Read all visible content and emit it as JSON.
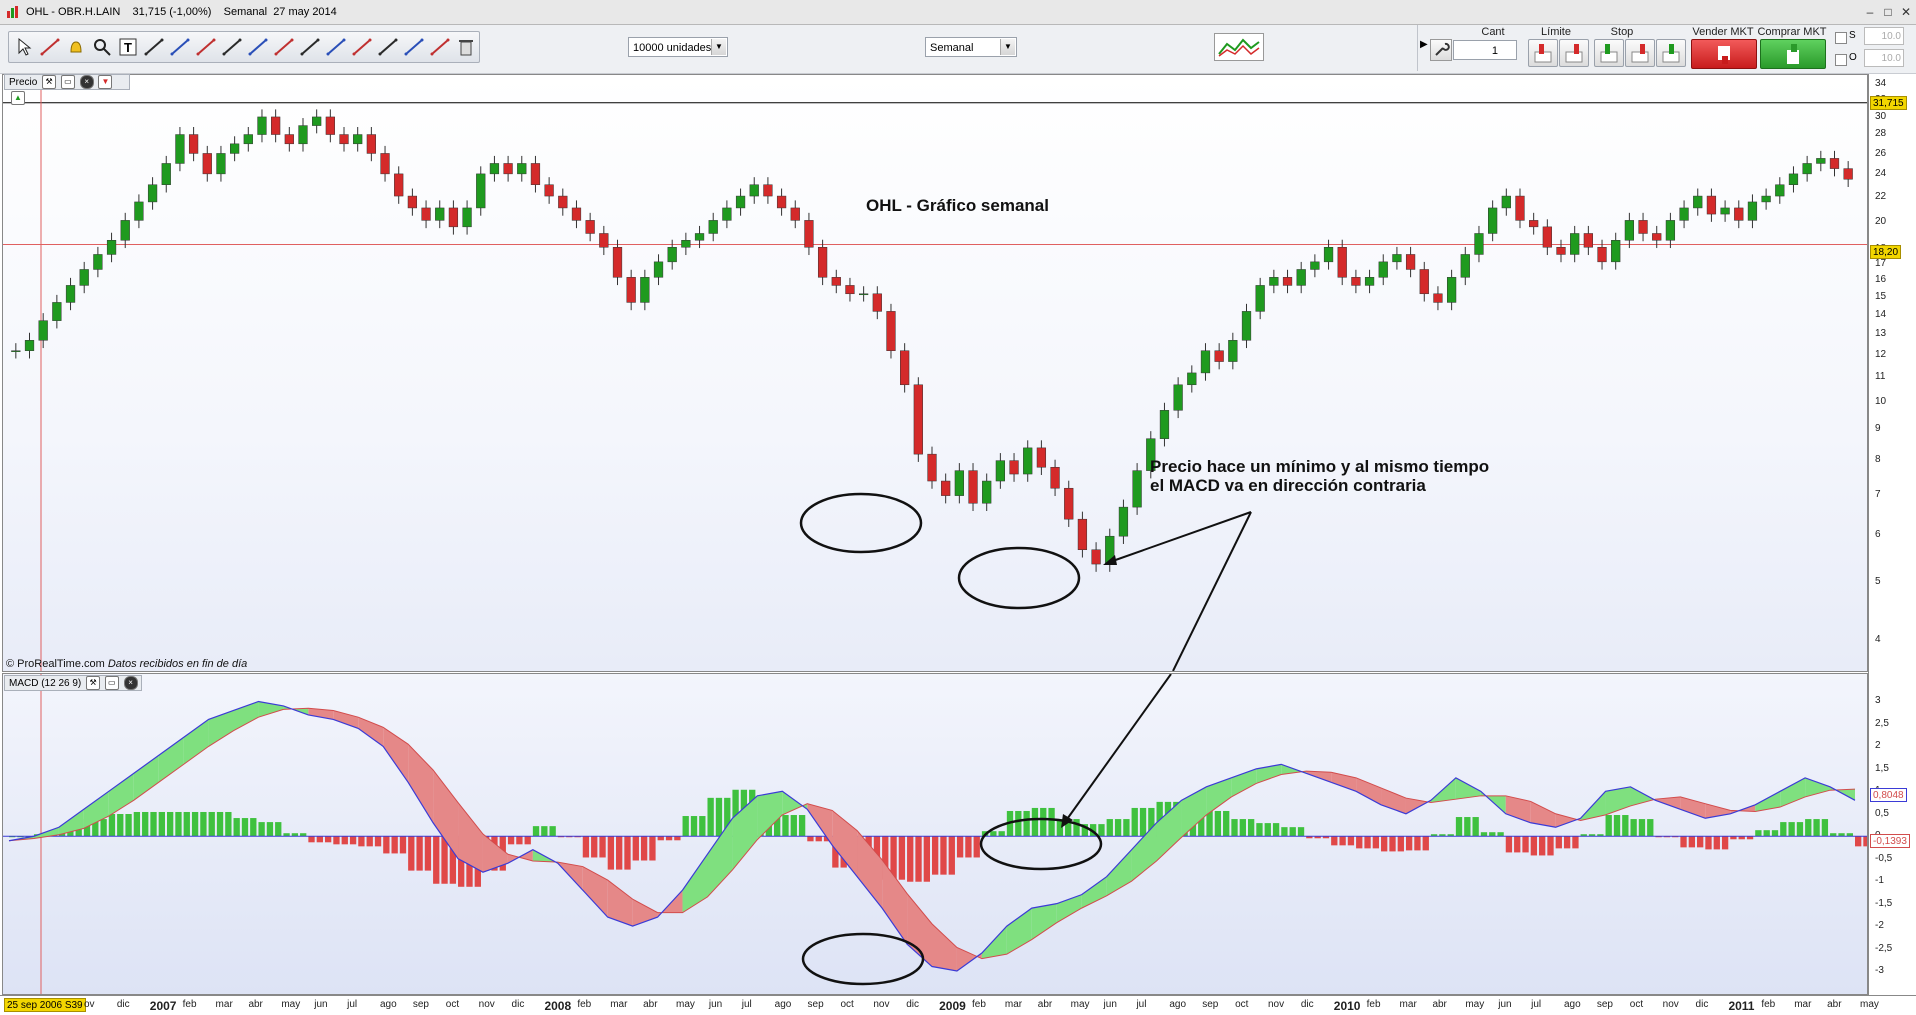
{
  "window": {
    "title": "OHL - OBR.H.LAIN    31,715 (-1,00%)    Semanal  27 may 2014",
    "minimize": "–",
    "maximize": "□",
    "close": "✕"
  },
  "toolbar": {
    "tools": [
      "cursor-icon",
      "ruler-icon",
      "alert-bell-icon",
      "zoom-icon",
      "text-icon",
      "trendline-red-icon",
      "fibonacci-icon",
      "line-icon",
      "ray-icon",
      "horizontal-line-icon",
      "vertical-line-icon",
      "channel-icon",
      "grid-icon",
      "zigzag-icon",
      "hammer-icon",
      "multiline-icon",
      "cross-icon",
      "trash-icon"
    ],
    "units_dropdown": "10000 unidades",
    "period_dropdown": "Semanal",
    "indicator_icon": "chart-thumbnail-icon"
  },
  "order_panel": {
    "cant_label": "Cant",
    "cant_value": "1",
    "limite_label": "Límite",
    "stop_label": "Stop",
    "sell_label": "Vender MKT",
    "buy_label": "Comprar MKT",
    "s_label": "S",
    "o_label": "O",
    "field1": "10.0",
    "field2": "10.0"
  },
  "price_pane": {
    "tab_label": "Precio",
    "chart_title": "OHL - Gráfico semanal",
    "annotation_line1": "Precio hace un mínimo y al mismo tiempo",
    "annotation_line2": "el MACD va en dirección contraria",
    "footer_source": "© ProRealTime.com",
    "footer_note": "Datos recibidos en fin de día",
    "last_price_badge": "31,715",
    "cursor_price_badge": "18,20",
    "y_ticks": [
      "34",
      "32",
      "30",
      "28",
      "26",
      "24",
      "22",
      "20",
      "18",
      "17",
      "16",
      "15",
      "14",
      "13",
      "12",
      "11",
      "10",
      "9",
      "8",
      "7",
      "6",
      "5",
      "4"
    ]
  },
  "macd_pane": {
    "tab_label": "MACD (12 26 9)",
    "badge_macd": "0,8048",
    "badge_hist": "-0,1393",
    "y_ticks": [
      "3",
      "2,5",
      "2",
      "1,5",
      "1",
      "0,5",
      "0",
      "-0,5",
      "-1",
      "-1,5",
      "-2",
      "-2,5",
      "-3"
    ]
  },
  "xaxis": {
    "cursor_date": "25 sep 2006 S39",
    "labels": [
      "ov",
      "dic",
      "2007",
      "feb",
      "mar",
      "abr",
      "may",
      "jun",
      "jul",
      "ago",
      "sep",
      "oct",
      "nov",
      "dic",
      "2008",
      "feb",
      "mar",
      "abr",
      "may",
      "jun",
      "jul",
      "ago",
      "sep",
      "oct",
      "nov",
      "dic",
      "2009",
      "feb",
      "mar",
      "abr",
      "may",
      "jun",
      "jul",
      "ago",
      "sep",
      "oct",
      "nov",
      "dic",
      "2010",
      "feb",
      "mar",
      "abr",
      "may",
      "jun",
      "jul",
      "ago",
      "sep",
      "oct",
      "nov",
      "dic",
      "2011",
      "feb",
      "mar",
      "abr",
      "may"
    ]
  },
  "colors": {
    "up_candle": "#1f9a1f",
    "down_candle": "#d42a2a",
    "macd_line": "#3b3bd6",
    "signal_line": "#d24c4c",
    "hist_up": "#3fc13f",
    "hist_down": "#e04848",
    "badge_yellow": "#f2d600"
  },
  "chart_data": {
    "type": "candlestick",
    "title": "OHL - Gráfico semanal",
    "price_series_weekly_close_approx": [
      12,
      12.5,
      13.5,
      14.5,
      15.5,
      16.5,
      17.5,
      18.5,
      20,
      21.5,
      23,
      25,
      28,
      26,
      24,
      26,
      27,
      28,
      30,
      28,
      27,
      29,
      30,
      28,
      27,
      28,
      26,
      24,
      22,
      21,
      20,
      21,
      19.5,
      21,
      24,
      25,
      24,
      25,
      23,
      22,
      21,
      20,
      19,
      18,
      16,
      14.5,
      16,
      17,
      18,
      18.5,
      19,
      20,
      21,
      22,
      23,
      22,
      21,
      20,
      18,
      16,
      15.5,
      15,
      15,
      14,
      12,
      10.5,
      8,
      7.2,
      6.8,
      7.5,
      6.6,
      7.2,
      7.8,
      7.4,
      8.2,
      7.6,
      7,
      6.2,
      5.5,
      5.2,
      5.8,
      6.5,
      7.5,
      8.5,
      9.5,
      10.5,
      11,
      12,
      11.5,
      12.5,
      14,
      15.5,
      16,
      15.5,
      16.5,
      17,
      18,
      16,
      15.5,
      16,
      17,
      17.5,
      16.5,
      15,
      14.5,
      16,
      17.5,
      19,
      21,
      22,
      20,
      19.5,
      18,
      17.5,
      19,
      18,
      17,
      18.5,
      20,
      19,
      18.5,
      20,
      21,
      22,
      20.5,
      21,
      20,
      21.5,
      22,
      23,
      24,
      25,
      25.5,
      24.5,
      23.5
    ],
    "macd_series_approx": [
      -0.1,
      0,
      0.2,
      0.6,
      1,
      1.4,
      1.8,
      2.2,
      2.6,
      2.8,
      3,
      2.9,
      2.7,
      2.6,
      2.4,
      2,
      1.2,
      0.3,
      -0.5,
      -0.8,
      -0.6,
      -0.3,
      -0.6,
      -1.2,
      -1.8,
      -2,
      -1.8,
      -1.2,
      -0.4,
      0.4,
      0.9,
      1,
      0.6,
      -0.2,
      -0.9,
      -1.6,
      -2.4,
      -2.9,
      -3,
      -2.6,
      -2,
      -1.6,
      -1.5,
      -1.3,
      -0.9,
      -0.3,
      0.3,
      0.8,
      1.1,
      1.3,
      1.5,
      1.6,
      1.4,
      1.2,
      1.0,
      0.7,
      0.5,
      0.8,
      1.3,
      1.0,
      0.5,
      0.3,
      0.2,
      0.4,
      1.0,
      1.1,
      0.8,
      0.6,
      0.4,
      0.5,
      0.7,
      1.0,
      1.3,
      1.1,
      0.8
    ],
    "ylim_price": [
      4,
      34
    ],
    "ylim_macd": [
      -3.2,
      3.3
    ]
  }
}
